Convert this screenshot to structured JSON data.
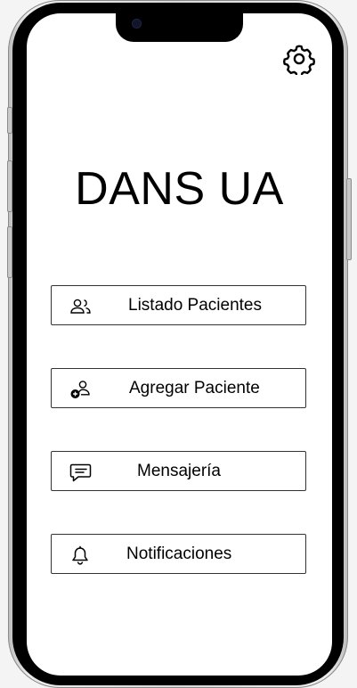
{
  "app": {
    "title": "DANS UA"
  },
  "menu": [
    {
      "label": "Listado Pacientes",
      "icon": "users-icon"
    },
    {
      "label": "Agregar Paciente",
      "icon": "add-user-icon"
    },
    {
      "label": "Mensajería",
      "icon": "message-icon"
    },
    {
      "label": "Notificaciones",
      "icon": "bell-icon"
    }
  ],
  "header": {
    "settings_icon": "gear-icon"
  }
}
